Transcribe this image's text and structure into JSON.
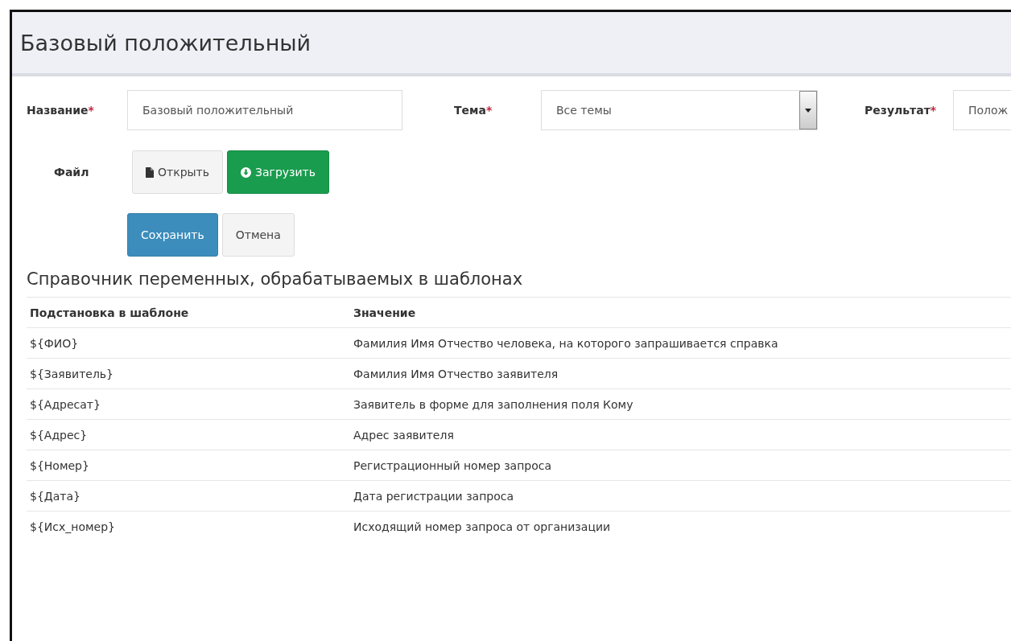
{
  "page_title": "Базовый положительный",
  "form_fields": [
    {
      "label": "Название",
      "required_mark": "*",
      "kind": "text",
      "value": "Базовый положительный"
    },
    {
      "label": "Тема",
      "required_mark": "*",
      "kind": "select",
      "value": "Все темы"
    },
    {
      "label": "Результат",
      "required_mark": "*",
      "kind": "text",
      "value": "Полож"
    }
  ],
  "file": {
    "label": "Файл",
    "buttons": [
      {
        "label": "Открыть",
        "kind": "open"
      },
      {
        "label": "Загрузить",
        "kind": "upload"
      }
    ]
  },
  "actions": [
    {
      "label": "Сохранить",
      "kind": "primary"
    },
    {
      "label": "Отмена",
      "kind": "default"
    }
  ],
  "reference": {
    "title": "Справочник переменных, обрабатываемых в шаблонах",
    "columns": [
      "Подстановка в шаблоне",
      "Значение"
    ],
    "rows": [
      [
        "${ФИО}",
        "Фамилия Имя Отчество человека, на которого запрашивается справка"
      ],
      [
        "${Заявитель}",
        "Фамилия Имя Отчество заявителя"
      ],
      [
        "${Адресат}",
        "Заявитель в форме для заполнения поля Кому"
      ],
      [
        "${Адрес}",
        "Адрес заявителя"
      ],
      [
        "${Номер}",
        "Регистрационный номер запроса"
      ],
      [
        "${Дата}",
        "Дата регистрации запроса"
      ],
      [
        "${Исх_номер}",
        "Исходящий номер запроса от организации"
      ]
    ]
  }
}
